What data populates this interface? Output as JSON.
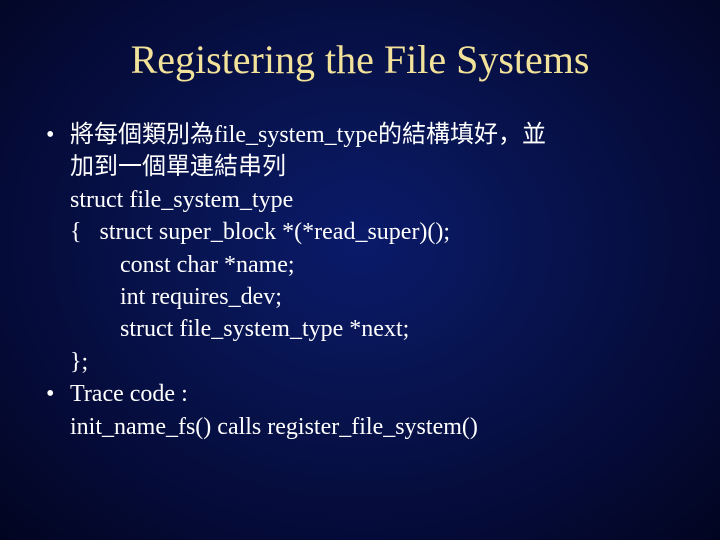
{
  "title": "Registering the File Systems",
  "bullet_glyph": "•",
  "item1": {
    "l1": "將每個類別為file_system_type的結構填好，並",
    "l2": "加到一個單連結串列",
    "l3": "struct file_system_type",
    "l4a": "{",
    "l4b": "struct super_block *(*read_super)();",
    "l5": "const char *name;",
    "l6": "int  requires_dev;",
    "l7": "struct file_system_type *next;",
    "l8": "};"
  },
  "item2": {
    "l1": "Trace code :",
    "l2": "init_name_fs() calls register_file_system()"
  }
}
